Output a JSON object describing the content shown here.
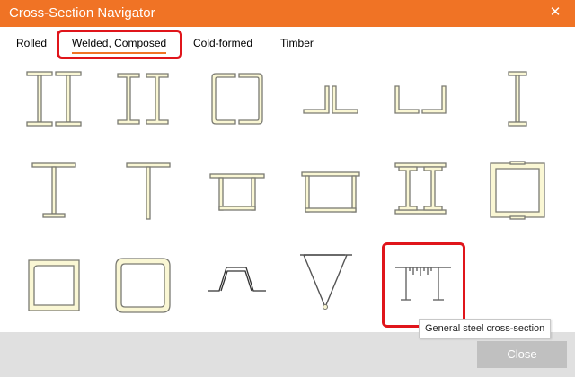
{
  "window": {
    "title": "Cross-Section Navigator",
    "close_icon": "close-x-icon",
    "glyph": "✕"
  },
  "tabs": [
    {
      "label": "Rolled",
      "active": false
    },
    {
      "label": "Welded, Composed",
      "active": true
    },
    {
      "label": "Cold-formed",
      "active": false
    },
    {
      "label": "Timber",
      "active": false
    }
  ],
  "sections": [
    {
      "name": "double-i-section-icon"
    },
    {
      "name": "double-channel-inward-icon"
    },
    {
      "name": "double-channel-box-icon"
    },
    {
      "name": "double-angle-back-to-back-icon"
    },
    {
      "name": "double-angle-spaced-icon"
    },
    {
      "name": "i-section-icon"
    },
    {
      "name": "t-section-flange-bottom-icon"
    },
    {
      "name": "t-section-icon"
    },
    {
      "name": "box-section-flange-top-icon"
    },
    {
      "name": "box-section-wide-icon"
    },
    {
      "name": "double-i-composed-icon"
    },
    {
      "name": "rectangular-hollow-section-icon"
    },
    {
      "name": "box-section-welded-corner-icon"
    },
    {
      "name": "square-hollow-section-icon"
    },
    {
      "name": "trapezoidal-section-icon"
    },
    {
      "name": "triangular-truss-section-icon"
    },
    {
      "name": "general-steel-cross-section-icon"
    }
  ],
  "tooltip": {
    "text": "General steel cross-section"
  },
  "footer": {
    "close_label": "Close"
  },
  "colors": {
    "accent": "#f07325",
    "highlight": "#e0151b",
    "fill": "#faf7d4",
    "stroke": "#7a7a72"
  }
}
